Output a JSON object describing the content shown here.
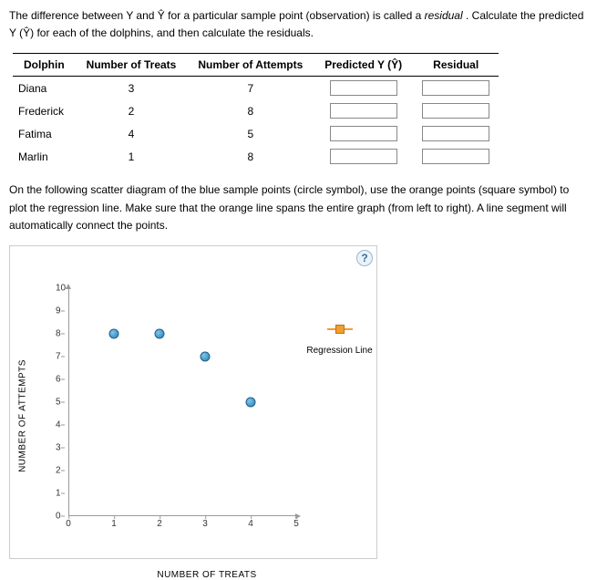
{
  "intro": {
    "sentence_a": "The difference between Y and Ŷ for a particular sample point (observation) is called a ",
    "residual_word": "residual",
    "sentence_b": ". Calculate the predicted Y (Ŷ) for each of the dolphins, and then calculate the residuals."
  },
  "table": {
    "headers": {
      "dolphin": "Dolphin",
      "treats": "Number of Treats",
      "attempts": "Number of Attempts",
      "predicted": "Predicted Y (Ŷ)",
      "residual": "Residual"
    },
    "rows": [
      {
        "name": "Diana",
        "treats": "3",
        "attempts": "7"
      },
      {
        "name": "Frederick",
        "treats": "2",
        "attempts": "8"
      },
      {
        "name": "Fatima",
        "treats": "4",
        "attempts": "5"
      },
      {
        "name": "Marlin",
        "treats": "1",
        "attempts": "8"
      }
    ]
  },
  "para2": "On the following scatter diagram of the blue sample points (circle symbol), use the orange points (square symbol) to plot the regression line. Make sure that the orange line spans the entire graph (from left to right). A line segment will automatically connect the points.",
  "chart": {
    "help": "?",
    "xlabel": "NUMBER OF TREATS",
    "ylabel": "NUMBER OF ATTEMPTS",
    "legend": "Regression Line"
  },
  "chart_data": {
    "type": "scatter",
    "title": "",
    "xlabel": "NUMBER OF TREATS",
    "ylabel": "NUMBER OF ATTEMPTS",
    "xlim": [
      0,
      5
    ],
    "ylim": [
      0,
      10
    ],
    "xticks": [
      0,
      1,
      2,
      3,
      4,
      5
    ],
    "yticks": [
      0,
      1,
      2,
      3,
      4,
      5,
      6,
      7,
      8,
      9,
      10
    ],
    "series": [
      {
        "name": "Sample Points",
        "symbol": "circle",
        "color": "#2b7fb4",
        "points": [
          {
            "x": 1,
            "y": 8
          },
          {
            "x": 2,
            "y": 8
          },
          {
            "x": 3,
            "y": 7
          },
          {
            "x": 4,
            "y": 5
          }
        ]
      }
    ],
    "legend_items": [
      {
        "name": "Regression Line",
        "symbol": "square-line",
        "color": "#f29d2f"
      }
    ]
  }
}
